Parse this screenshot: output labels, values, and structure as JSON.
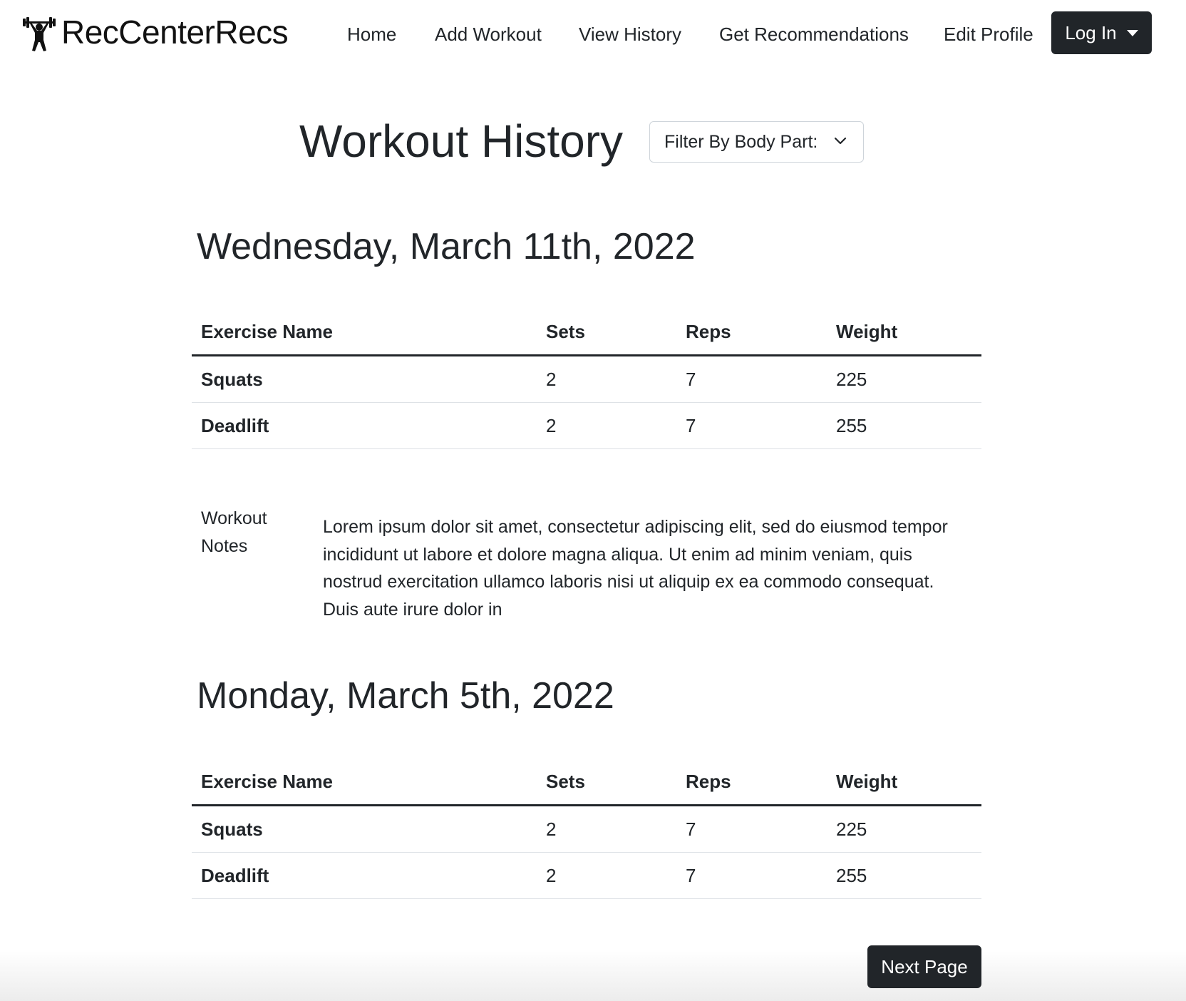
{
  "navbar": {
    "brand": "RecCenterRecs",
    "brand_icon": "weightlifter-icon",
    "links": [
      "Home",
      "Add Workout",
      "View History",
      "Get Recommendations",
      "Edit Profile"
    ],
    "login_label": "Log In",
    "login_icon": "caret-down-icon"
  },
  "header": {
    "title": "Workout History",
    "filter_label": "Filter By Body Part:",
    "filter_icon": "chevron-down-icon"
  },
  "table_headers": [
    "Exercise Name",
    "Sets",
    "Reps",
    "Weight"
  ],
  "workouts": [
    {
      "date": "Wednesday, March 11th, 2022",
      "exercises": [
        {
          "name": "Squats",
          "sets": "2",
          "reps": "7",
          "weight": "225"
        },
        {
          "name": "Deadlift",
          "sets": "2",
          "reps": "7",
          "weight": "255"
        }
      ],
      "notes_label": "Workout Notes",
      "notes": "Lorem ipsum dolor sit amet, consectetur adipiscing elit, sed do eiusmod tempor incididunt ut labore et dolore magna aliqua. Ut enim ad minim veniam, quis nostrud exercitation ullamco laboris nisi ut aliquip ex ea commodo consequat. Duis aute irure dolor in"
    },
    {
      "date": "Monday, March 5th, 2022",
      "exercises": [
        {
          "name": "Squats",
          "sets": "2",
          "reps": "7",
          "weight": "225"
        },
        {
          "name": "Deadlift",
          "sets": "2",
          "reps": "7",
          "weight": "255"
        }
      ]
    }
  ],
  "pagination": {
    "next_label": "Next Page"
  },
  "colors": {
    "dark": "#212529",
    "border": "#dee2e6",
    "text": "#212529"
  }
}
